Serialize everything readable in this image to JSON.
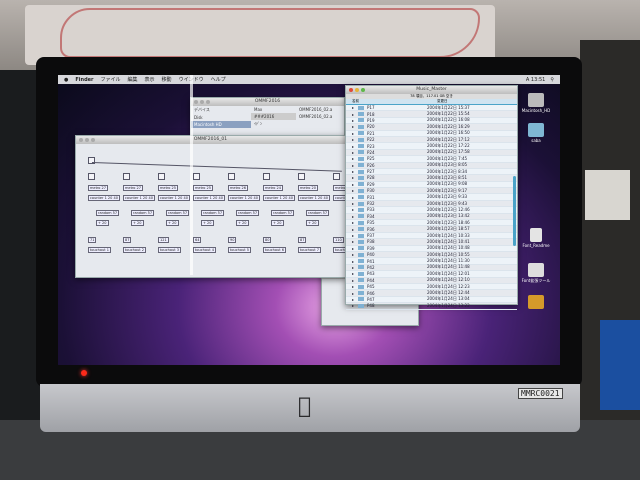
{
  "menubar": {
    "apple": "",
    "items": [
      "Finder",
      "ファイル",
      "編集",
      "表示",
      "移動",
      "ウインドウ",
      "ヘルプ"
    ],
    "clock": "A 13:51",
    "search_icon": "magnifier-icon"
  },
  "finder_window": {
    "title": "OMMF2016",
    "sidebar_header": "デバイス",
    "sidebar_items": [
      "Disk",
      "Macintosh HD"
    ],
    "column": [
      "Max",
      "###2016",
      "ｲﾃﾞﾝ"
    ],
    "files": [
      "OMMF2016_02.a",
      "OMMF2016_02.a"
    ]
  },
  "max_window": {
    "title": "OMMF2016_01",
    "metro": [
      "metro 27",
      "metro 27",
      "metro 25",
      "metro 25",
      "metro 26",
      "metro 24",
      "metro 20",
      "metro 28"
    ],
    "counter": "counter 1 20 40",
    "random": "random 57",
    "ops": [
      "+ 20",
      "+ 20",
      "+ 20",
      "+ 20",
      "+ 20",
      "+ 20",
      "+ 20"
    ],
    "numbers": [
      "71",
      "87",
      "121",
      "64",
      "90",
      "80",
      "87",
      "110"
    ],
    "outs": [
      "touchout 1",
      "touchout 2",
      "touchout 3",
      "touchout 4",
      "touchout 5",
      "touchout 6",
      "touchout 7",
      "touchout 8"
    ]
  },
  "music_window": {
    "title": "Music_Master",
    "status": "78 項目、117.01 GB 空き",
    "col_name": "名前",
    "col_date": "変更日",
    "rows": [
      {
        "name": "P17",
        "date": "2004年1月22日 15:37"
      },
      {
        "name": "P18",
        "date": "2004年1月22日 15:54"
      },
      {
        "name": "P19",
        "date": "2004年1月22日 16:08"
      },
      {
        "name": "P20",
        "date": "2004年1月22日 16:29"
      },
      {
        "name": "P21",
        "date": "2004年1月22日 16:50"
      },
      {
        "name": "P22",
        "date": "2004年1月22日 17:12"
      },
      {
        "name": "P23",
        "date": "2004年1月22日 17:22"
      },
      {
        "name": "P24",
        "date": "2004年1月22日 17:58"
      },
      {
        "name": "P25",
        "date": "2004年1月23日 7:45"
      },
      {
        "name": "P26",
        "date": "2004年1月23日 8:05"
      },
      {
        "name": "P27",
        "date": "2004年1月23日 8:34"
      },
      {
        "name": "P28",
        "date": "2004年1月23日 8:51"
      },
      {
        "name": "P29",
        "date": "2004年1月23日 9:08"
      },
      {
        "name": "P30",
        "date": "2004年1月23日 9:17"
      },
      {
        "name": "P31",
        "date": "2004年1月23日 9:33"
      },
      {
        "name": "P32",
        "date": "2004年1月23日 9:43"
      },
      {
        "name": "P33",
        "date": "2004年1月23日 12:46"
      },
      {
        "name": "P34",
        "date": "2004年1月23日 13:42"
      },
      {
        "name": "P35",
        "date": "2004年1月23日 18:46"
      },
      {
        "name": "P36",
        "date": "2004年1月23日 18:57"
      },
      {
        "name": "P37",
        "date": "2004年1月24日 10:33"
      },
      {
        "name": "P38",
        "date": "2004年1月24日 10:41"
      },
      {
        "name": "P39",
        "date": "2004年1月24日 10:48"
      },
      {
        "name": "P40",
        "date": "2004年1月24日 10:55"
      },
      {
        "name": "P41",
        "date": "2004年1月24日 11:30"
      },
      {
        "name": "P42",
        "date": "2004年1月24日 11:48"
      },
      {
        "name": "P43",
        "date": "2004年1月24日 12:01"
      },
      {
        "name": "P44",
        "date": "2004年1月24日 12:10"
      },
      {
        "name": "P45",
        "date": "2004年1月24日 12:23"
      },
      {
        "name": "P46",
        "date": "2004年1月24日 12:44"
      },
      {
        "name": "P47",
        "date": "2004年1月24日 13:04"
      },
      {
        "name": "P48",
        "date": "2004年1月24日 13:22"
      }
    ]
  },
  "desktop_icons": [
    "Macintosh_HD",
    "saba",
    "Font_Readme",
    "Font拡張ツール",
    "disk-image"
  ],
  "bezel_label": "MMRC0021",
  "colors": {
    "finder_accent": "#4aa3c8",
    "led": "#ff2a1a"
  }
}
